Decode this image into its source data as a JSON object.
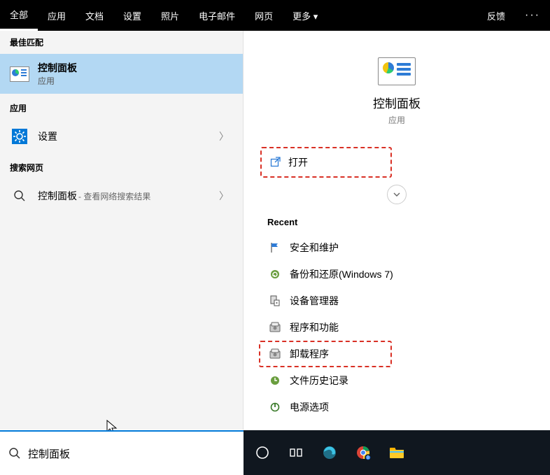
{
  "tabs": {
    "items": [
      "全部",
      "应用",
      "文档",
      "设置",
      "照片",
      "电子邮件",
      "网页",
      "更多 ▾"
    ],
    "active_index": 0,
    "feedback": "反馈"
  },
  "left": {
    "best_match_header": "最佳匹配",
    "best_match": {
      "title": "控制面板",
      "subtitle": "应用"
    },
    "apps_header": "应用",
    "apps_item": {
      "title": "设置"
    },
    "web_header": "搜索网页",
    "web_item": {
      "title": "控制面板",
      "suffix": " - 查看网络搜索结果"
    }
  },
  "right": {
    "hero_title": "控制面板",
    "hero_subtitle": "应用",
    "open_label": "打开",
    "recent_header": "Recent",
    "recent": [
      {
        "label": "安全和维护",
        "icon": "flag"
      },
      {
        "label": "备份和还原(Windows 7)",
        "icon": "backup"
      },
      {
        "label": "设备管理器",
        "icon": "device"
      },
      {
        "label": "程序和功能",
        "icon": "programs"
      },
      {
        "label": "卸载程序",
        "icon": "programs",
        "highlight": true
      },
      {
        "label": "文件历史记录",
        "icon": "history"
      },
      {
        "label": "电源选项",
        "icon": "power"
      }
    ]
  },
  "search": {
    "value": "控制面板"
  }
}
